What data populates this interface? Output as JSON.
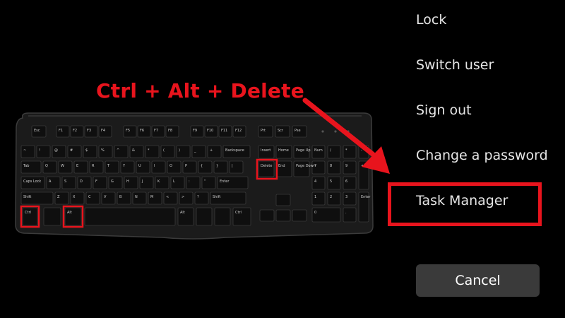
{
  "shortcut": {
    "label": "Ctrl + Alt + Delete",
    "color": "#e8141d"
  },
  "menu": {
    "items": [
      {
        "id": "lock",
        "label": "Lock"
      },
      {
        "id": "switch-user",
        "label": "Switch user"
      },
      {
        "id": "sign-out",
        "label": "Sign out"
      },
      {
        "id": "change-password",
        "label": "Change a password"
      },
      {
        "id": "task-manager",
        "label": "Task Manager",
        "highlighted": true
      }
    ],
    "cancel_label": "Cancel"
  },
  "keyboard": {
    "highlighted_keys": [
      "Ctrl",
      "Alt",
      "Delete"
    ],
    "keys": {
      "esc": "Esc",
      "f_keys": [
        "F1",
        "F2",
        "F3",
        "F4",
        "F5",
        "F6",
        "F7",
        "F8",
        "F9",
        "F10",
        "F11",
        "F12"
      ],
      "print": "Print Screen",
      "scroll": "Scroll Lock",
      "pause": "Pause Break",
      "number_row": [
        "~",
        "!",
        "@",
        "#",
        "$",
        "%",
        "^",
        "&",
        "*",
        "(",
        ")",
        "_",
        "+"
      ],
      "backspace": "Backspace",
      "tab": "Tab",
      "qwerty_row": [
        "Q",
        "W",
        "E",
        "R",
        "T",
        "Y",
        "U",
        "I",
        "O",
        "P",
        "{",
        "}",
        "|"
      ],
      "caps": "Caps Lock",
      "home_row": [
        "A",
        "S",
        "D",
        "F",
        "G",
        "H",
        "J",
        "K",
        "L",
        ":",
        "\""
      ],
      "enter": "Enter",
      "shift": "Shift",
      "bottom_letters": [
        "Z",
        "X",
        "C",
        "V",
        "B",
        "N",
        "M",
        "<",
        ">",
        "?"
      ],
      "ctrl": "Ctrl",
      "alt": "Alt",
      "alt_gr": "Alt",
      "ctrl_right": "Ctrl",
      "insert": "Insert",
      "home": "Home",
      "page_up": "Page Up",
      "delete": "Delete",
      "end": "End",
      "page_down": "Page Down",
      "num_lock": "Num Lock",
      "numpad": [
        "/",
        "*",
        "-",
        "7",
        "8",
        "9",
        "+",
        "4",
        "5",
        "6",
        "1",
        "2",
        "3",
        "Enter",
        "0",
        "."
      ]
    }
  }
}
